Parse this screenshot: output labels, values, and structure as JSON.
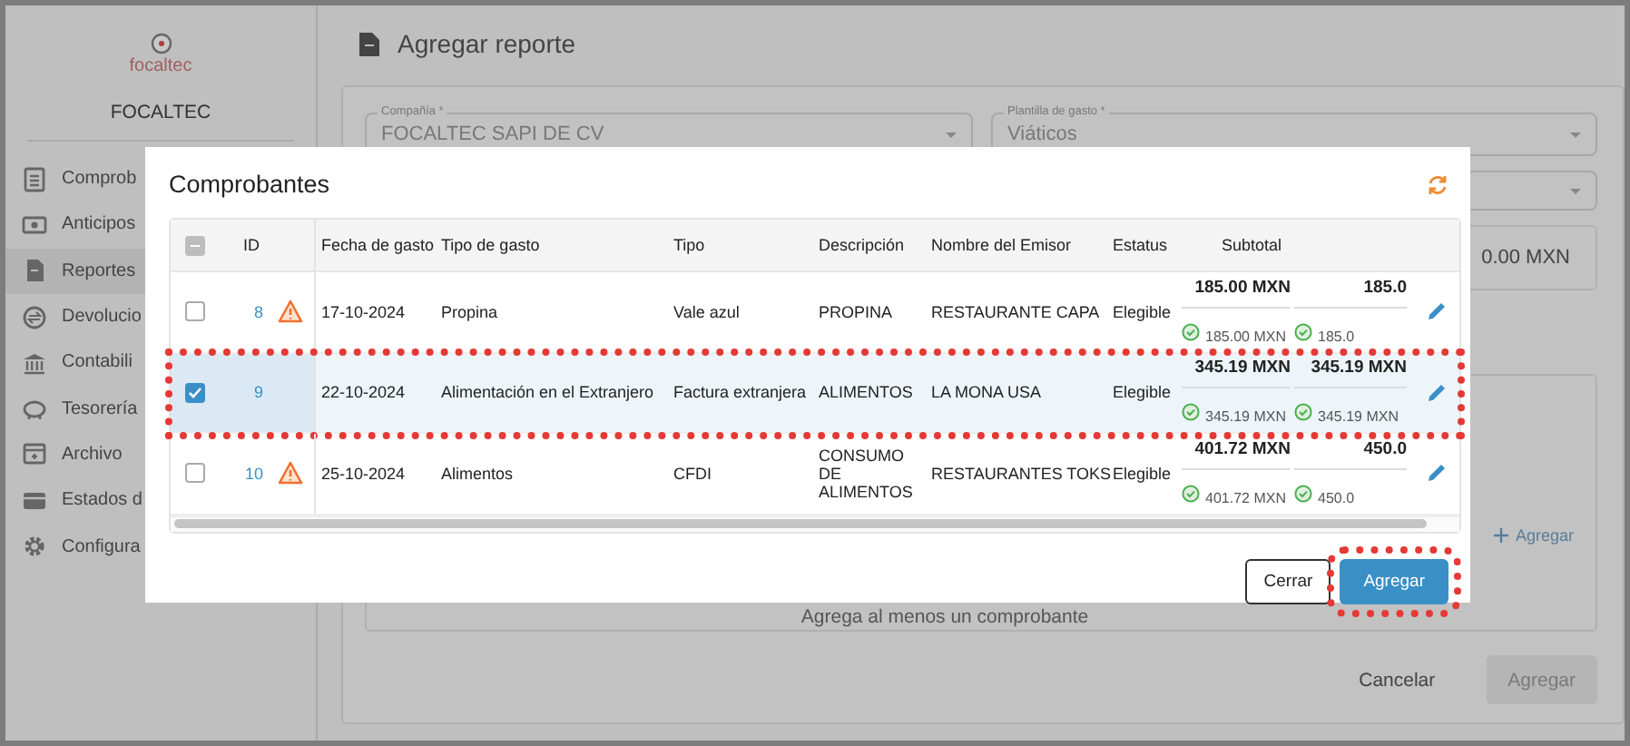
{
  "sidebar": {
    "brand": "focaltec",
    "company": "FOCALTEC",
    "items": [
      {
        "label": "Comprob",
        "selected": false
      },
      {
        "label": "Anticipos",
        "selected": false
      },
      {
        "label": "Reportes",
        "selected": true
      },
      {
        "label": "Devolucio",
        "selected": false
      },
      {
        "label": "Contabili",
        "selected": false
      },
      {
        "label": "Tesorería",
        "selected": false
      },
      {
        "label": "Archivo",
        "selected": false
      },
      {
        "label": "Estados d",
        "selected": false
      },
      {
        "label": "Configura",
        "selected": false
      }
    ]
  },
  "page": {
    "title": "Agregar reporte",
    "fields": [
      {
        "label": "Compañía *",
        "value": "FOCALTEC SAPI DE CV"
      },
      {
        "label": "Plantilla de gasto *",
        "value": "Viáticos"
      }
    ],
    "total": "0.00 MXN",
    "add_link": "Agregar",
    "empty_message": "Agrega al menos un comprobante",
    "buttons": [
      {
        "label": "Cancelar",
        "kind": "text",
        "disabled": false
      },
      {
        "label": "Agregar",
        "kind": "primary",
        "disabled": true
      }
    ]
  },
  "dialog": {
    "title": "Comprobantes",
    "select_all_indeterminate": true,
    "columns": [
      "ID",
      "Fecha de gasto",
      "Tipo de gasto",
      "Tipo",
      "Descripción",
      "Nombre del Emisor",
      "Estatus",
      "Subtotal"
    ],
    "rows": [
      {
        "checked": false,
        "highlighted": false,
        "id": "8",
        "warning": true,
        "date": "17-10-2024",
        "expense_type": "Propina",
        "type": "Vale azul",
        "description": "PROPINA",
        "issuer": "RESTAURANTE CAPA",
        "status": "Elegible",
        "subtotal": "185.00 MXN",
        "subtotal_check": "185.00 MXN",
        "column_10": "185.0",
        "column_10_check": "185.0"
      },
      {
        "checked": true,
        "highlighted": true,
        "id": "9",
        "warning": false,
        "date": "22-10-2024",
        "expense_type": "Alimentación en el Extranjero",
        "type": "Factura extranjera",
        "description": "ALIMENTOS",
        "issuer": "LA MONA USA",
        "status": "Elegible",
        "subtotal": "345.19 MXN",
        "subtotal_check": "345.19 MXN",
        "column_10": "345.19 MXN",
        "column_10_check": "345.19 MXN"
      },
      {
        "checked": false,
        "highlighted": false,
        "id": "10",
        "warning": true,
        "date": "25-10-2024",
        "expense_type": "Alimentos",
        "type": "CFDI",
        "description": "CONSUMO DE ALIMENTOS",
        "issuer": "RESTAURANTES TOKS",
        "status": "Elegible",
        "subtotal": "401.72 MXN",
        "subtotal_check": "401.72 MXN",
        "column_10": "450.0",
        "column_10_check": "450.0"
      }
    ],
    "buttons": [
      {
        "label": "Cerrar",
        "kind": "outline",
        "highlighted": false
      },
      {
        "label": "Agregar",
        "kind": "primary",
        "highlighted": true
      }
    ]
  }
}
